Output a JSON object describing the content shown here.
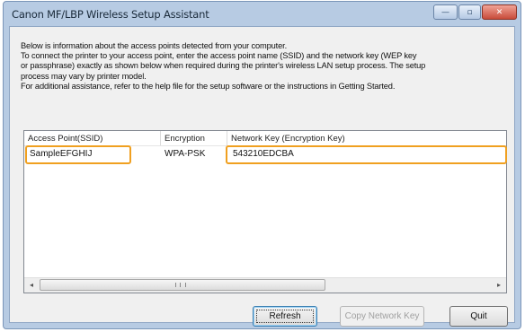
{
  "window": {
    "title": "Canon MF/LBP Wireless Setup Assistant",
    "minimize": "—",
    "maximize": "▫",
    "close": "✕"
  },
  "info_lines": [
    "Below is information about the access points detected from your computer.",
    "To connect the printer to your access point, enter the access point name (SSID) and the network key (WEP key",
    "or passphrase) exactly as shown below when required during the printer's wireless LAN setup process. The setup",
    "process may vary by printer model.",
    "For additional assistance, refer to the help file for the setup software or the instructions in Getting Started."
  ],
  "table": {
    "columns": [
      "Access Point(SSID)",
      "Encryption",
      "Network Key (Encryption Key)"
    ],
    "rows": [
      {
        "ssid": "SampleEFGHIJ",
        "encryption": "WPA-PSK",
        "key": "543210EDCBA"
      }
    ]
  },
  "scrollbar": {
    "left_arrow": "◂",
    "right_arrow": "▸"
  },
  "buttons": {
    "refresh": "Refresh",
    "copy_key": "Copy Network Key",
    "quit": "Quit"
  },
  "colors": {
    "highlight": "#f0a020",
    "title_bar": "#b7cbe3",
    "close_button": "#c84b3a"
  }
}
